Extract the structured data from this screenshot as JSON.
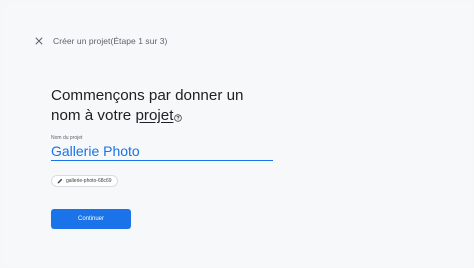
{
  "header": {
    "close_icon": "close-icon",
    "step_title": "Créer un projet(Étape 1 sur 3)"
  },
  "main": {
    "headline_line1": "Commençons par donner un",
    "headline_line2_prefix": "nom à votre",
    "headline_link": "projet",
    "help_icon": "help-circle-icon",
    "field_label": "Nom du projet",
    "field_value": "Gallerie Photo",
    "project_id_icon": "pencil-icon",
    "project_id": "gallerie-photo-68c69",
    "continue_label": "Continuer"
  },
  "colors": {
    "accent": "#1a73e8",
    "background": "#f7f8fa",
    "text": "#202124",
    "muted": "#5f6368"
  }
}
